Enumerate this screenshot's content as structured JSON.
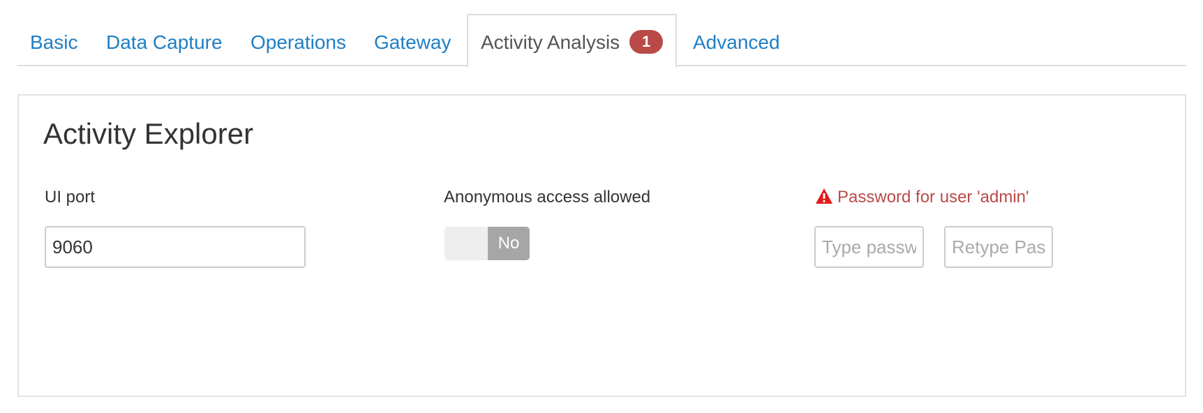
{
  "tabs": [
    {
      "label": "Basic",
      "active": false
    },
    {
      "label": "Data Capture",
      "active": false
    },
    {
      "label": "Operations",
      "active": false
    },
    {
      "label": "Gateway",
      "active": false
    },
    {
      "label": "Activity Analysis",
      "active": true,
      "badge": "1"
    },
    {
      "label": "Advanced",
      "active": false
    }
  ],
  "panel": {
    "title": "Activity Explorer",
    "ui_port": {
      "label": "UI port",
      "value": "9060"
    },
    "anonymous_access": {
      "label": "Anonymous access allowed",
      "toggle_label": "No",
      "enabled": false
    },
    "admin_password": {
      "label": "Password for user 'admin'",
      "icon": "warning-icon",
      "password_placeholder": "Type password",
      "retype_placeholder": "Retype Password"
    }
  },
  "colors": {
    "link": "#1f7fc4",
    "error": "#b94a48",
    "badge": "#b94a48",
    "toggle_off": "#a6a6a6"
  }
}
